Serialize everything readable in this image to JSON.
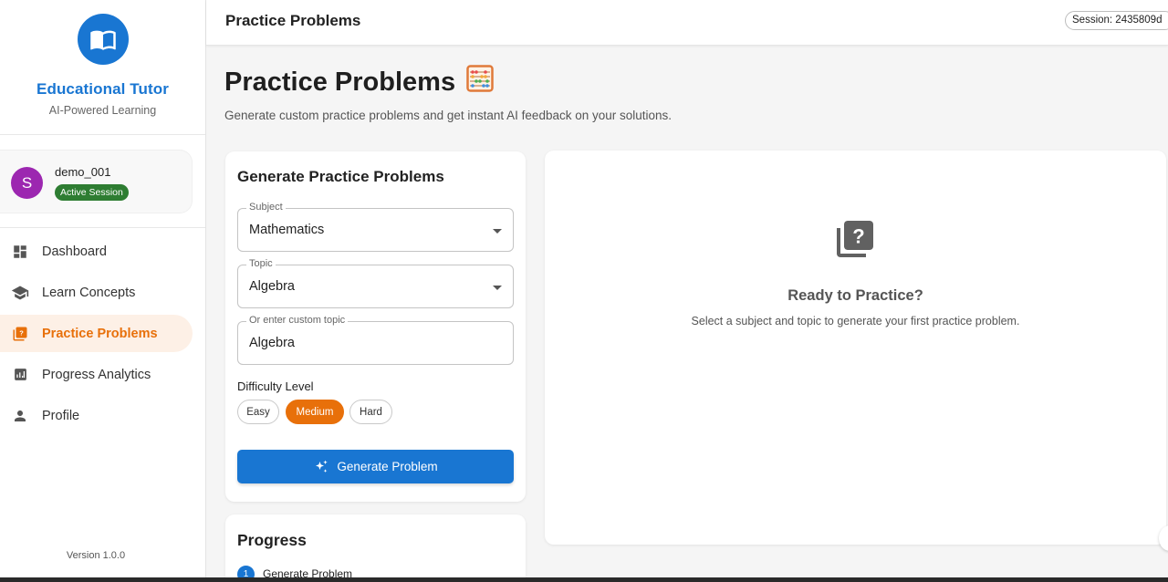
{
  "app": {
    "brand_title": "Educational Tutor",
    "brand_subtitle": "AI-Powered Learning",
    "version": "Version 1.0.0"
  },
  "user": {
    "initial": "S",
    "name": "demo_001",
    "status_badge": "Active Session"
  },
  "nav": {
    "items": [
      {
        "label": "Dashboard",
        "icon": "dashboard-icon"
      },
      {
        "label": "Learn Concepts",
        "icon": "graduation-cap-icon"
      },
      {
        "label": "Practice Problems",
        "icon": "quiz-icon",
        "active": true
      },
      {
        "label": "Progress Analytics",
        "icon": "analytics-icon"
      },
      {
        "label": "Profile",
        "icon": "person-icon"
      }
    ]
  },
  "topbar": {
    "title": "Practice Problems",
    "session": "Session: 2435809d"
  },
  "page": {
    "title": "Practice Problems",
    "title_emoji": "abacus-icon",
    "subtitle": "Generate custom practice problems and get instant AI feedback on your solutions."
  },
  "generate": {
    "title": "Generate Practice Problems",
    "subject": {
      "label": "Subject",
      "value": "Mathematics"
    },
    "topic": {
      "label": "Topic",
      "value": "Algebra"
    },
    "custom_topic": {
      "label": "Or enter custom topic",
      "value": "Algebra"
    },
    "difficulty_label": "Difficulty Level",
    "difficulties": [
      "Easy",
      "Medium",
      "Hard"
    ],
    "selected_difficulty": "Medium",
    "button_label": "Generate Problem"
  },
  "progress": {
    "title": "Progress",
    "steps": [
      {
        "number": "1",
        "label": "Generate Problem"
      }
    ]
  },
  "ready": {
    "title": "Ready to Practice?",
    "subtitle": "Select a subject and topic to generate your first practice problem."
  },
  "colors": {
    "primary": "#1976d2",
    "accent": "#e8700a",
    "avatar": "#9c27b0",
    "badge": "#2e7d32"
  }
}
